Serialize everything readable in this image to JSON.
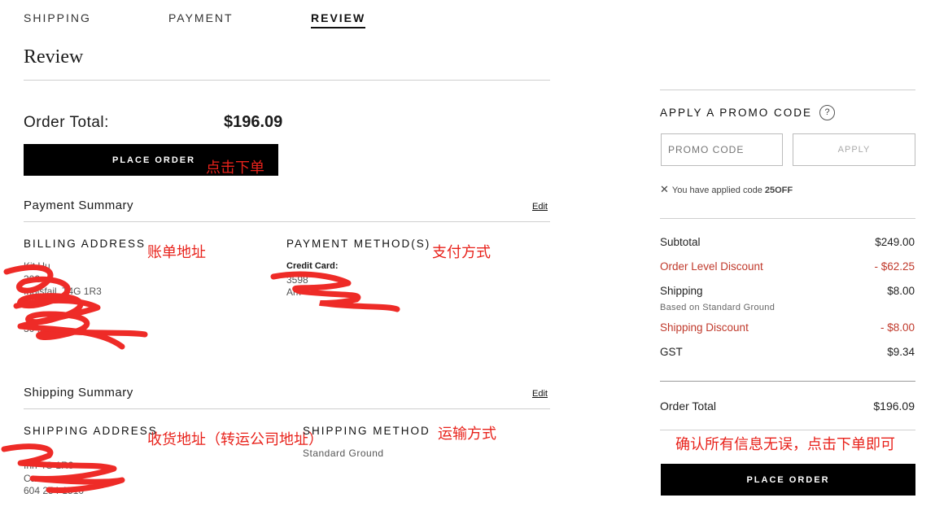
{
  "steps": {
    "shipping": "SHIPPING",
    "payment": "PAYMENT",
    "review": "REVIEW"
  },
  "page_title": "Review",
  "order_total": {
    "label": "Order Total:",
    "value": "$196.09"
  },
  "place_order_label": "PLACE ORDER",
  "annotations": {
    "place_order": "点击下单",
    "billing": "账单地址",
    "payment_method": "支付方式",
    "shipping_address": "收货地址（转运公司地址）",
    "shipping_method": "运输方式",
    "confirm": "确认所有信息无误，点击下单即可"
  },
  "payment_summary": {
    "title": "Payment Summary",
    "edit": "Edit",
    "billing_heading": "BILLING ADDRESS",
    "billing_lines": [
      "Kit    Hu",
      "  302",
      "Innisfail,     T4G 1R3",
      "C",
      "",
      "30         .com"
    ],
    "method_heading": "PAYMENT METHOD(S)",
    "credit_card_label": "Credit Card:",
    "card_lines": [
      "              3598",
      "              ",
      "Am"
    ]
  },
  "shipping_summary": {
    "title": "Shipping Summary",
    "edit": "Edit",
    "address_heading": "SHIPPING ADDRESS",
    "address_lines": [
      "",
      "           ",
      "Inn              4G 1R3",
      "Cana",
      "604  254-1510"
    ],
    "method_heading": "SHIPPING METHOD",
    "method_value": "Standard Ground"
  },
  "promo": {
    "title": "APPLY A PROMO CODE",
    "help_icon": "?",
    "placeholder": "PROMO CODE",
    "apply_label": "APPLY",
    "applied_prefix": "You have applied code",
    "applied_code": "25OFF"
  },
  "summary": {
    "subtotal_label": "Subtotal",
    "subtotal": "$249.00",
    "order_discount_label": "Order Level Discount",
    "order_discount": "- $62.25",
    "shipping_label": "Shipping",
    "shipping": "$8.00",
    "shipping_note": "Based on Standard Ground",
    "shipping_discount_label": "Shipping Discount",
    "shipping_discount": "- $8.00",
    "gst_label": "GST",
    "gst": "$9.34",
    "total_label": "Order Total",
    "total": "$196.09"
  },
  "colors": {
    "discount": "#c0392b",
    "annotation": "#e8221b",
    "button": "#000000"
  }
}
